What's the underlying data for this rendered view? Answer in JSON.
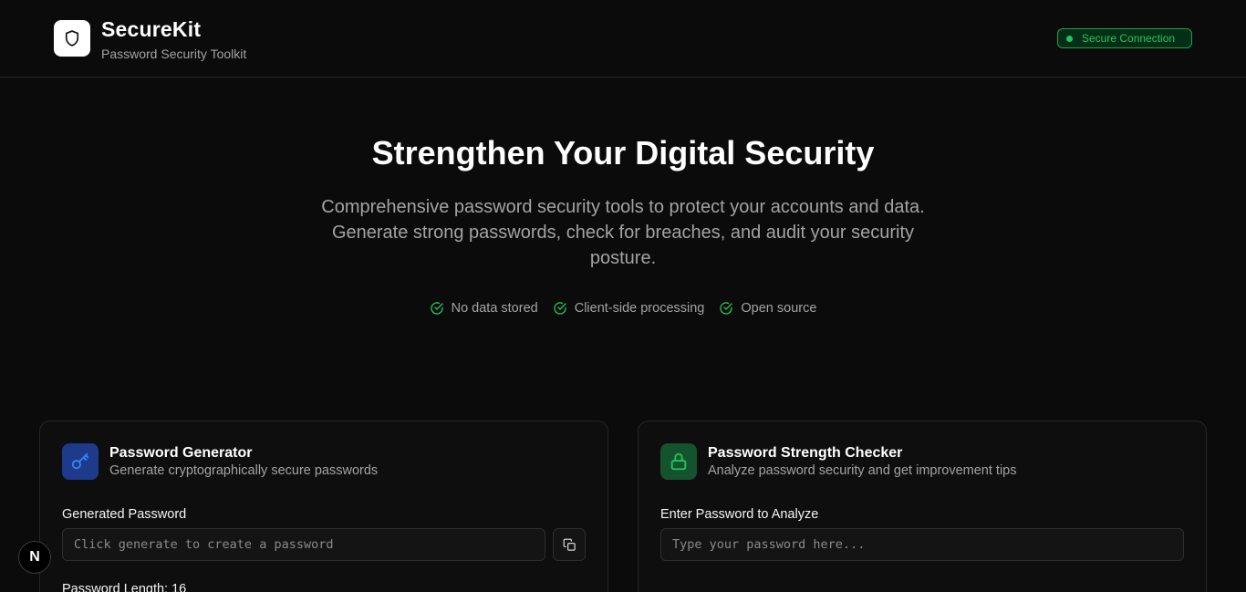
{
  "header": {
    "brand_name": "SecureKit",
    "brand_subtitle": "Password Security Toolkit",
    "status_badge": "Secure Connection",
    "logo_icon": "shield-icon"
  },
  "hero": {
    "title": "Strengthen Your Digital Security",
    "description": "Comprehensive password security tools to protect your accounts and data. Generate strong passwords, check for breaches, and audit your security posture.",
    "features": [
      {
        "label": "No data stored",
        "icon": "check-circle-icon"
      },
      {
        "label": "Client-side processing",
        "icon": "check-circle-icon"
      },
      {
        "label": "Open source",
        "icon": "check-circle-icon"
      }
    ]
  },
  "generator": {
    "title": "Password Generator",
    "subtitle": "Generate cryptographically secure passwords",
    "icon": "key-icon",
    "field_label": "Generated Password",
    "placeholder": "Click generate to create a password",
    "copy_icon": "copy-icon",
    "length_label": "Password Length: 16"
  },
  "checker": {
    "title": "Password Strength Checker",
    "subtitle": "Analyze password security and get improvement tips",
    "icon": "lock-icon",
    "field_label": "Enter Password to Analyze",
    "placeholder": "Type your password here..."
  },
  "dev_badge": {
    "label": "N"
  },
  "colors": {
    "background": "#0b0b0b",
    "accent_green": "#22c55e",
    "accent_blue": "#2563eb"
  }
}
